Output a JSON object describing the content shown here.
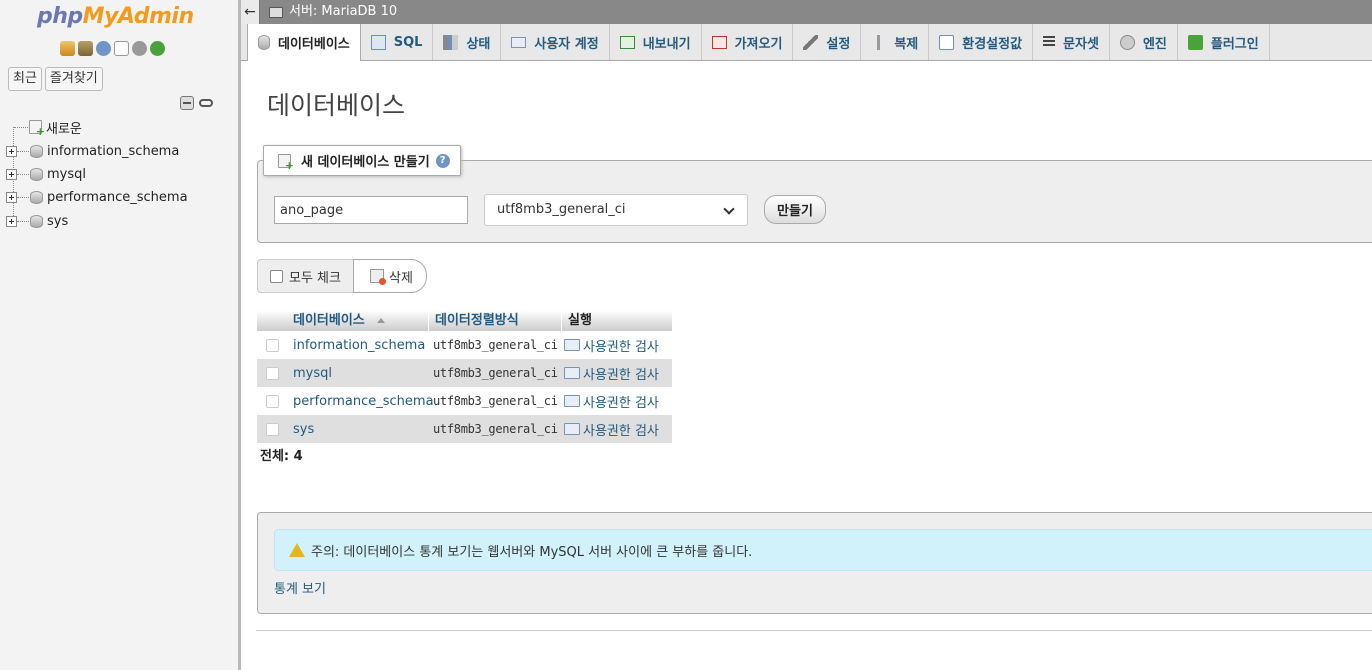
{
  "sidebar": {
    "logo_php": "php",
    "logo_admin": "MyAdmin",
    "recent_label": "최근",
    "favorites_label": "즐겨찾기",
    "tree": [
      {
        "label": "새로운",
        "kind": "new"
      },
      {
        "label": "information_schema",
        "kind": "db"
      },
      {
        "label": "mysql",
        "kind": "db"
      },
      {
        "label": "performance_schema",
        "kind": "db"
      },
      {
        "label": "sys",
        "kind": "db"
      }
    ]
  },
  "topbar": {
    "back_symbol": "←",
    "server_label": "서버: MariaDB 10"
  },
  "tabs": [
    {
      "label": "데이터베이스",
      "icon": "database-icon",
      "active": true
    },
    {
      "label": "SQL",
      "icon": "sql-icon"
    },
    {
      "label": "상태",
      "icon": "status-icon"
    },
    {
      "label": "사용자 계정",
      "icon": "user-accounts-icon"
    },
    {
      "label": "내보내기",
      "icon": "export-icon"
    },
    {
      "label": "가져오기",
      "icon": "import-icon"
    },
    {
      "label": "설정",
      "icon": "wrench-icon"
    },
    {
      "label": "복제",
      "icon": "replication-icon"
    },
    {
      "label": "환경설정값",
      "icon": "variables-icon"
    },
    {
      "label": "문자셋",
      "icon": "charset-icon"
    },
    {
      "label": "엔진",
      "icon": "engine-icon"
    },
    {
      "label": "플러그인",
      "icon": "plugin-icon"
    }
  ],
  "main": {
    "page_title": "데이터베이스",
    "create_db": {
      "legend": "새 데이터베이스 만들기",
      "help_symbol": "?",
      "name_value": "ano_page",
      "collation_value": "utf8mb3_general_ci",
      "create_button": "만들기"
    },
    "check_all_label": "모두 체크",
    "delete_label": "삭제",
    "table": {
      "headers": [
        "데이터베이스",
        "데이터정렬방식",
        "실행"
      ],
      "rows": [
        {
          "name": "information_schema",
          "collation": "utf8mb3_general_ci",
          "action": "사용권한 검사"
        },
        {
          "name": "mysql",
          "collation": "utf8mb3_general_ci",
          "action": "사용권한 검사"
        },
        {
          "name": "performance_schema",
          "collation": "utf8mb3_general_ci",
          "action": "사용권한 검사"
        },
        {
          "name": "sys",
          "collation": "utf8mb3_general_ci",
          "action": "사용권한 검사"
        }
      ],
      "total": "전체: 4"
    },
    "notice": {
      "text": "주의: 데이터베이스 통계 보기는 웹서버와 MySQL 서버 사이에 큰 부하를 줍니다.",
      "stats_link": "통계 보기"
    }
  },
  "colors": {
    "link": "#235a81",
    "notice_bg": "#d1f2fb",
    "logo_php": "#6c78b3",
    "logo_admin": "#f29b1d"
  }
}
